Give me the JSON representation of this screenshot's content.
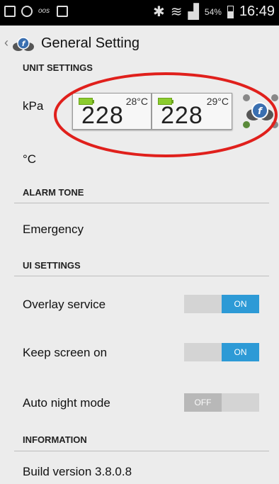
{
  "status_bar": {
    "time": "16:49",
    "battery_percent": "54%",
    "left_icons": [
      "gallery-icon",
      "app-icon",
      "app-text-icon",
      "image-icon"
    ],
    "right_icons": [
      "bluetooth-icon",
      "wifi-icon",
      "signal-icon",
      "battery-icon"
    ]
  },
  "header": {
    "back_glyph": "‹",
    "title": "General Setting"
  },
  "sections": {
    "unit_settings": "UNIT SETTINGS",
    "alarm_tone": "ALARM TONE",
    "ui_settings": "UI SETTINGS",
    "information": "INFORMATION"
  },
  "items": {
    "pressure_unit": "kPa",
    "temperature_unit": "°C",
    "alarm_tone": "Emergency",
    "overlay_service": "Overlay service",
    "keep_screen_on": "Keep screen on",
    "auto_night_mode": "Auto night mode",
    "build_version": "Build version  3.8.0.8"
  },
  "toggles": {
    "overlay_service": "ON",
    "keep_screen_on": "ON",
    "auto_night_mode": "OFF"
  },
  "overlay_widget": {
    "left_tire": {
      "pressure": "228",
      "temperature": "28°C"
    },
    "right_tire": {
      "pressure": "228",
      "temperature": "29°C"
    }
  },
  "colors": {
    "toggle_on": "#2d9ad6",
    "toggle_off": "#b6b6b6",
    "annotation": "#e0201c",
    "battery_indicator": "#8ccc2e"
  }
}
